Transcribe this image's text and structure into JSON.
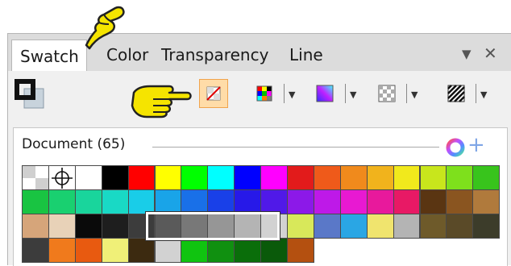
{
  "tabs": [
    "Swatch",
    "Color",
    "Transparency",
    "Line"
  ],
  "window_buttons": {
    "menu": "▼",
    "close": "✕"
  },
  "toolbar_icons": [
    "fill-stroke-icon",
    "no-color-swatch-icon",
    "color-grid-icon",
    "gradient-icon",
    "pattern-icon",
    "hatch-icon"
  ],
  "document": {
    "label": "Document (65)"
  },
  "swatch_rows": [
    [
      "#d0d0d0",
      "#ffffff",
      "#ffffff",
      "#000000",
      "#ff0000",
      "#ffff00",
      "#00ff00",
      "#00ffff",
      "#0000ff",
      "#ff00ff",
      "#e21b1b",
      "#ef5a1a",
      "#f08a1c",
      "#f1b31c",
      "#f1e91c",
      "#c8e61c",
      "#7ee01c",
      "#38c41c"
    ],
    [
      "#19c442",
      "#19d070",
      "#19d59c",
      "#19d9c5",
      "#19cde8",
      "#19a4e8",
      "#1970e8",
      "#1940e8",
      "#2719e8",
      "#5019e8",
      "#8c19e8",
      "#be19e8",
      "#e819d2",
      "#e8199c",
      "#e81965",
      "#5a3512",
      "#8a5520",
      "#b07a3c"
    ],
    [
      "#d6a57a",
      "#e8d2b8",
      "#0a0a0a",
      "#1e1e1e",
      "#3c3c3c",
      "#5a5a5a",
      "#787878",
      "#969696",
      "#b4b4b4",
      "#d2d2d2",
      "#d8e85a",
      "#5a78c8",
      "#2aa6e4",
      "#f0e46e",
      "#b4b4b4",
      "#6e5a2a",
      "#5a4a28",
      "#3c3c2a"
    ],
    [
      "#3c3c3c",
      "#f07a1c",
      "#e85a10",
      "#f0f078",
      "#3c2a10",
      "#d2d2d2",
      "#10c410",
      "#109010",
      "#0a6e0a",
      "#0a5a0a",
      "#b45010"
    ]
  ],
  "colors": {
    "accent": "#f0a44d",
    "hand": "#f5e400"
  }
}
